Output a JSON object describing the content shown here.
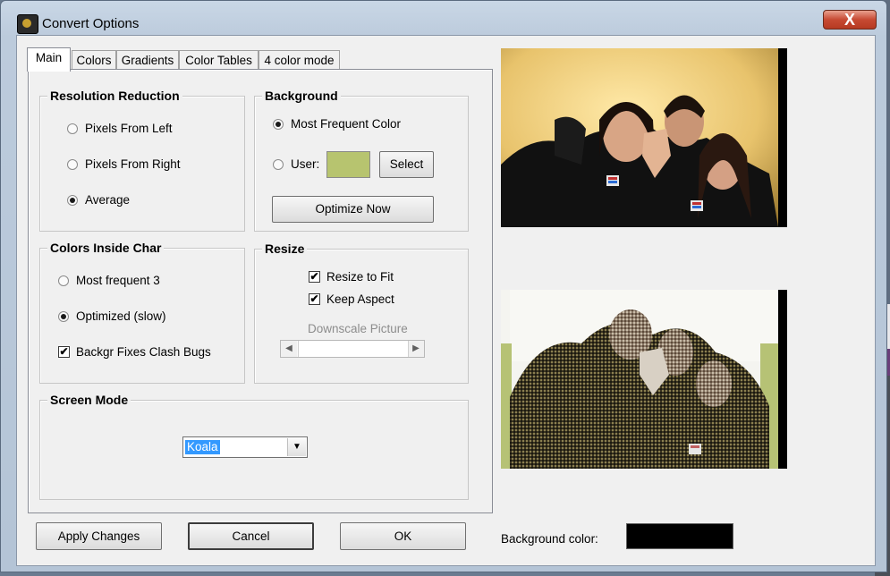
{
  "window": {
    "title": "Convert Options",
    "close_glyph": "X"
  },
  "tabs": [
    "Main",
    "Colors",
    "Gradients",
    "Color Tables",
    "4 color mode"
  ],
  "resolution": {
    "title": "Resolution Reduction",
    "options": [
      "Pixels From Left",
      "Pixels From Right",
      "Average"
    ],
    "selected": "Average"
  },
  "background": {
    "title": "Background",
    "most_frequent_label": "Most Frequent Color",
    "user_label": "User:",
    "selected": "Most Frequent Color",
    "user_color": "#b7c46f",
    "select_label": "Select",
    "optimize_label": "Optimize Now"
  },
  "colors_inside": {
    "title": "Colors Inside Char",
    "option_most_frequent": "Most frequent 3",
    "option_optimized": "Optimized (slow)",
    "selected": "Optimized (slow)",
    "backgr_fix_label": "Backgr Fixes Clash Bugs",
    "backgr_fix_checked": true
  },
  "resize": {
    "title": "Resize",
    "resize_to_fit_label": "Resize to Fit",
    "resize_to_fit_checked": true,
    "keep_aspect_label": "Keep Aspect",
    "keep_aspect_checked": true,
    "downscale_label": "Downscale Picture"
  },
  "screen_mode": {
    "title": "Screen Mode",
    "value": "Koala"
  },
  "buttons": {
    "apply": "Apply Changes",
    "cancel": "Cancel",
    "ok": "OK"
  },
  "bg_color": {
    "label": "Background color:",
    "value": "#000000"
  },
  "icons": {
    "check": "✔",
    "arrow_down": "▼",
    "arrow_left": "◀",
    "arrow_right": "▶"
  }
}
